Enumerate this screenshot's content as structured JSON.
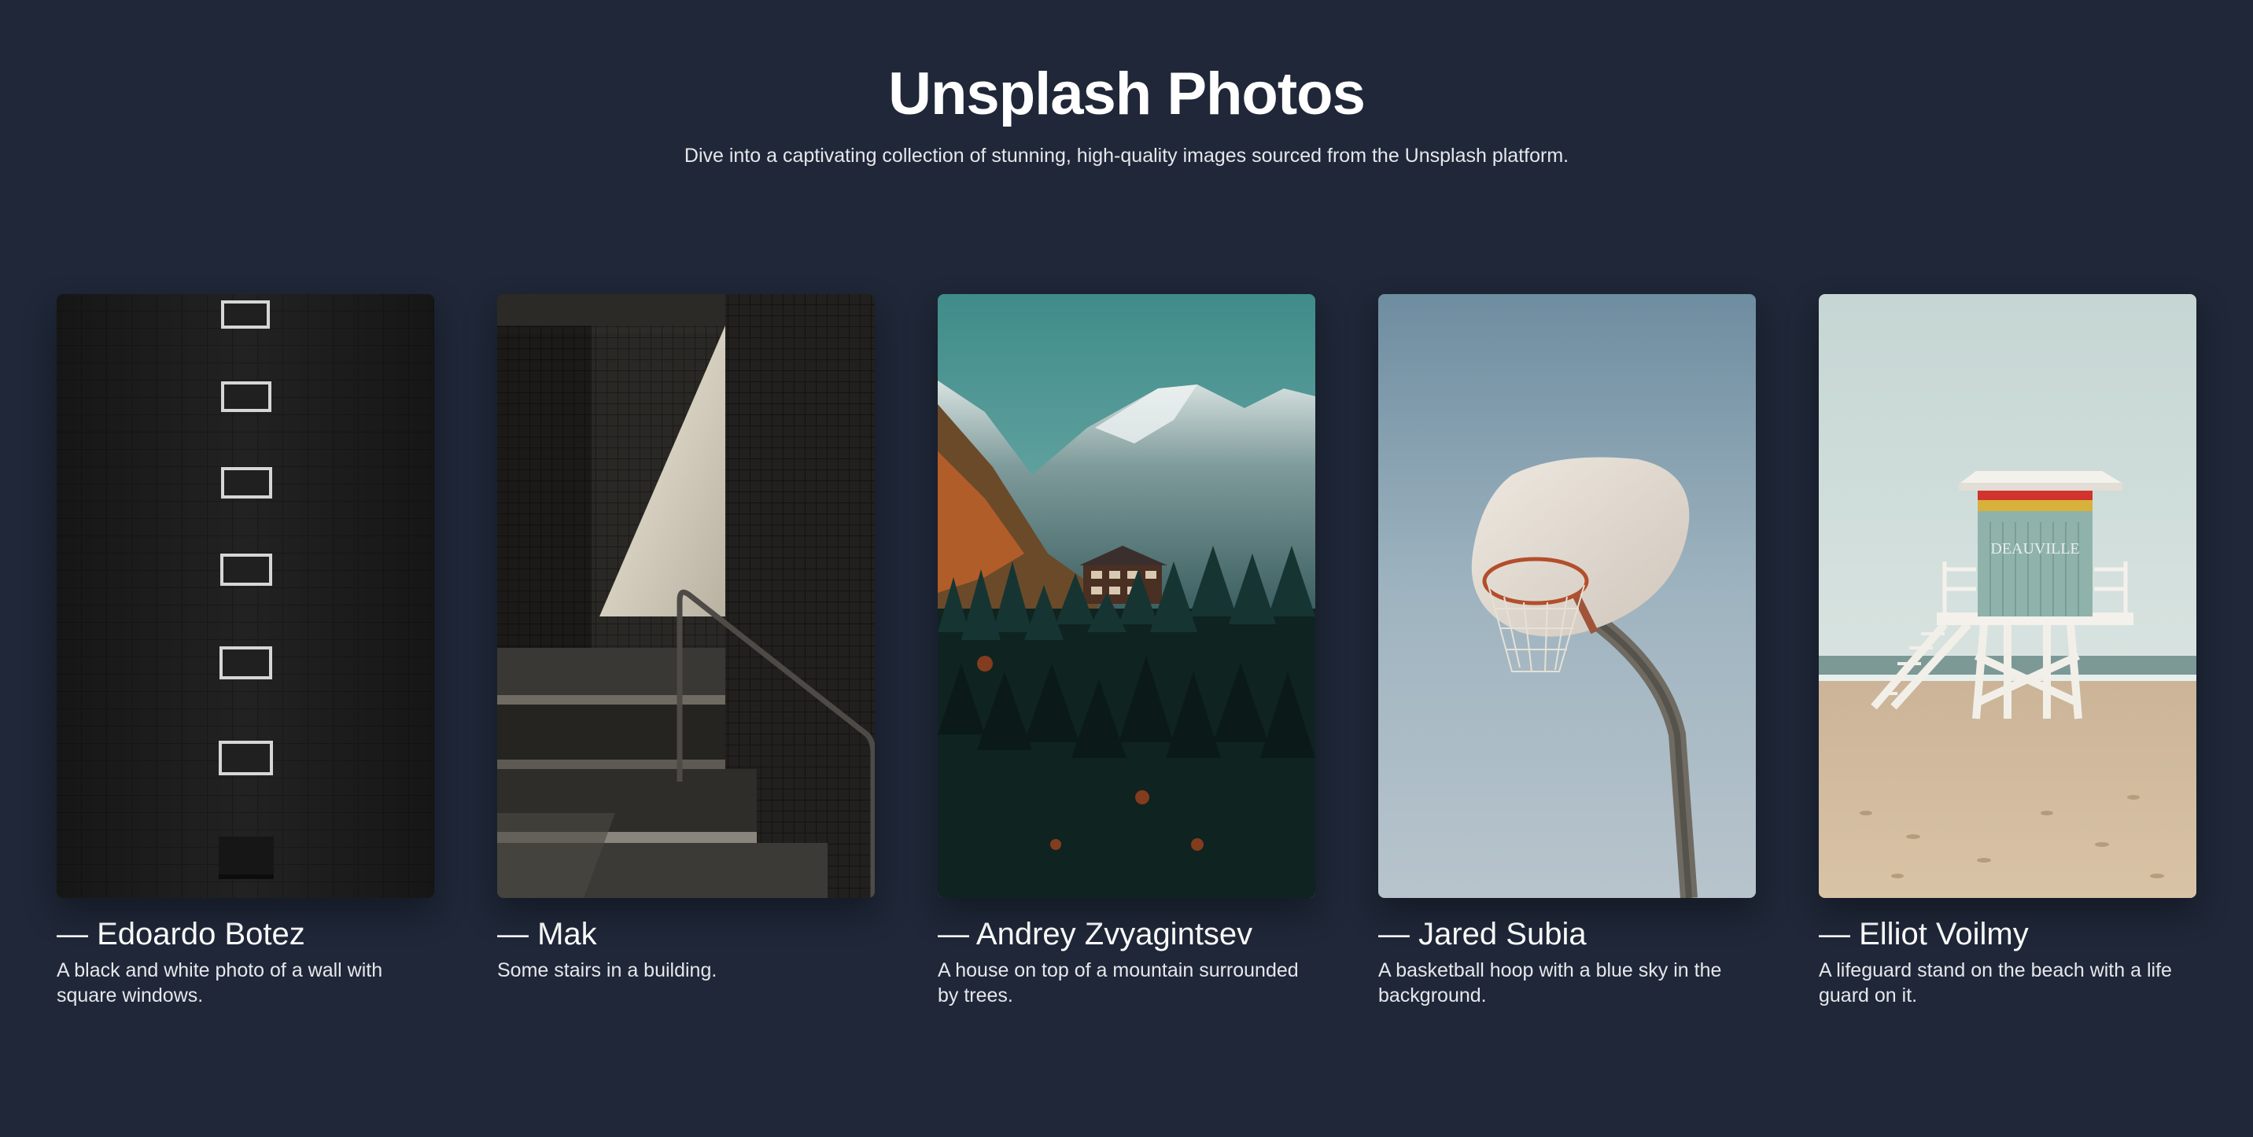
{
  "page": {
    "title": "Unsplash Photos",
    "subtitle": "Dive into a captivating collection of stunning, high-quality images sourced from the Unsplash platform."
  },
  "colors": {
    "background": "#1f2738",
    "text": "#ffffff",
    "muted_text": "#e5e7eb"
  },
  "photos": [
    {
      "author": "— Edoardo Botez",
      "description": "A black and white photo of a wall with square windows."
    },
    {
      "author": "— Mak",
      "description": "Some stairs in a building."
    },
    {
      "author": "— Andrey Zvyagintsev",
      "description": "A house on top of a mountain surrounded by trees."
    },
    {
      "author": "— Jared Subia",
      "description": "A basketball hoop with a blue sky in the background."
    },
    {
      "author": "— Elliot Voilmy",
      "description": "A lifeguard stand on the beach with a life guard on it.",
      "photo_sign": "DEAUVILLE"
    }
  ]
}
